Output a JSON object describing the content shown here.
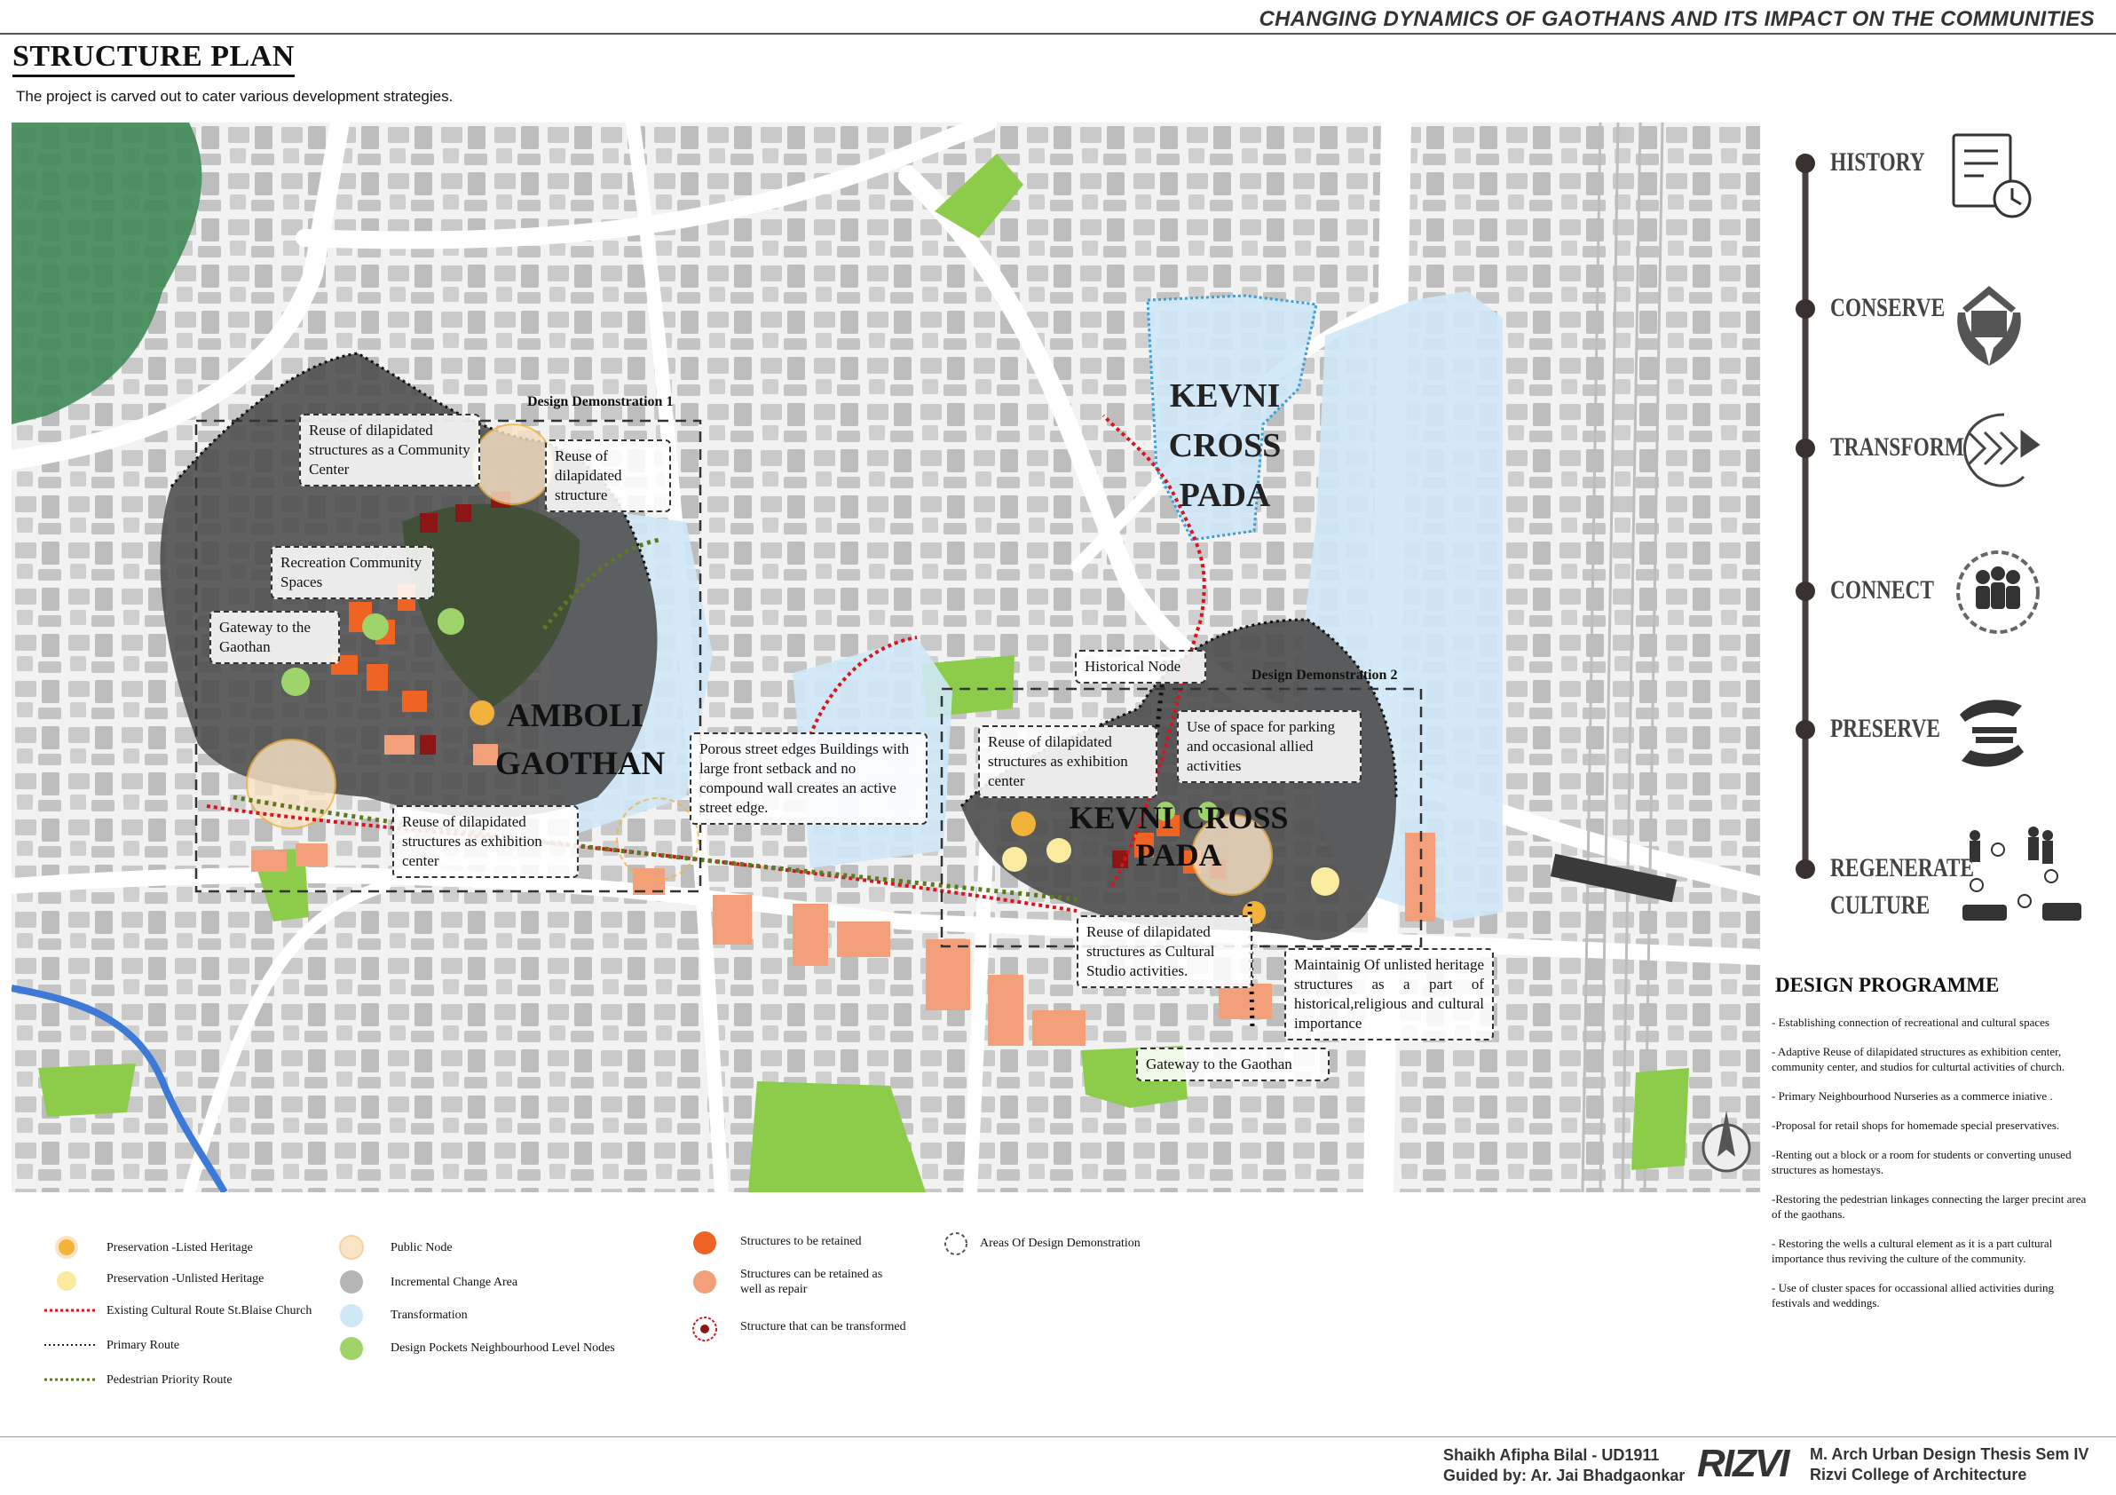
{
  "header": {
    "title": "CHANGING DYNAMICS OF GAOTHANS AND ITS IMPACT ON THE COMMUNITIES"
  },
  "page": {
    "title": "STRUCTURE PLAN",
    "subtitle": "The project is carved out to cater various development strategies."
  },
  "map": {
    "areas": {
      "amboli": "AMBOLI GAOTHAN",
      "amboli_line1": "AMBOLI",
      "amboli_line2": "GAOTHAN",
      "kevni_top_line1": "KEVNI",
      "kevni_top_line2": "CROSS PADA",
      "kevni_bottom": "KEVNI CROSS PADA"
    },
    "demonstrations": {
      "demo1": "Design Demonstration 1",
      "demo2": "Design Demonstration 2"
    },
    "callouts": {
      "reuse_community_center": "Reuse of dilapidated structures as a Community Center",
      "reuse_dilapidated": "Reuse of dilapidated structure",
      "recreation": "Recreation Community Spaces",
      "gateway_left": "Gateway to the Gaothan",
      "reuse_exhibition_left": "Reuse of dilapidated structures as exhibition center",
      "porous_edges": "Porous street edges Buildings with large front setback  and no compound wall creates an active street edge.",
      "historical_node": "Historical Node",
      "reuse_exhibition_right": "Reuse of dilapidated structures as exhibition center",
      "parking_use": "Use of space for parking and occasional allied activities",
      "reuse_cultural_studio": "Reuse of dilapidated structures as Cultural Studio activities.",
      "maintaining_heritage": "Maintainig Of unlisted heritage structures as a part of historical,religious and cultural importance",
      "gateway_bottom": "Gateway to the Gaothan"
    }
  },
  "programme": {
    "steps": [
      {
        "label": "HISTORY",
        "icon": "document-clock-icon"
      },
      {
        "label": "CONSERVE",
        "icon": "hands-house-icon"
      },
      {
        "label": "TRANSFORM",
        "icon": "chevrons-circle-icon"
      },
      {
        "label": "CONNECT",
        "icon": "people-circle-icon"
      },
      {
        "label": "PRESERVE",
        "icon": "hands-layers-icon"
      },
      {
        "label": "REGENERATE",
        "label2": "CULTURE",
        "icon": "community-cycle-icon"
      }
    ]
  },
  "design_programme": {
    "title": "DESIGN PROGRAMME",
    "items": [
      "- Establishing connection of recreational and cultural spaces",
      "- Adaptive Reuse of dilapidated structures as exhibition center, community center, and studios for culturtal activities of church.",
      "- Primary Neighbourhood Nurseries as a commerce iniative .",
      "-Proposal for retail shops for homemade special preservatives.",
      "-Renting out a block or a room for students or converting unused structures as homestays.",
      "-Restoring the pedestrian linkages connecting the larger precint area of the gaothans.",
      "- Restoring the wells a cultural element as it is a part cultural importance thus reviving the culture of the community.",
      "- Use of cluster spaces for occassional allied activities during festivals and weddings."
    ]
  },
  "legend": {
    "listed_heritage": "Preservation -Listed Heritage",
    "unlisted_heritage": "Preservation -Unlisted Heritage",
    "cultural_route": "Existing Cultural Route St.Blaise Church",
    "primary_route": "Primary Route",
    "pedestrian_route": "Pedestrian Priority Route",
    "public_node": "Public Node",
    "incremental": "Incremental Change Area",
    "transformation": "Transformation",
    "design_pockets": "Design Pockets Neighbourhood Level Nodes",
    "retained": "Structures to be retained",
    "repair": "Structures can be retained as well as repair",
    "transformed": "Structure that can be transformed",
    "design_demo_areas": "Areas Of Design Demonstration"
  },
  "colors": {
    "listed_heritage": "#f2b33a",
    "unlisted_heritage": "#fbeb9e",
    "public_node": "#fbe4c6",
    "incremental": "#b5b5b5",
    "transformation": "#cfe8f7",
    "design_pockets": "#9fd46b",
    "retained": "#f06423",
    "repair": "#f3a07a",
    "transformed": "#8c1616",
    "cultural_route": "#d8141e",
    "pedestrian_route": "#5d7a1e"
  },
  "footer": {
    "author": "Shaikh Afipha  Bilal - UD1911",
    "guide": "Guided by: Ar. Jai Bhadgaonkar",
    "logo": "RIZVI",
    "course": "M. Arch Urban Design Thesis Sem IV",
    "college": "Rizvi College of Architecture"
  }
}
